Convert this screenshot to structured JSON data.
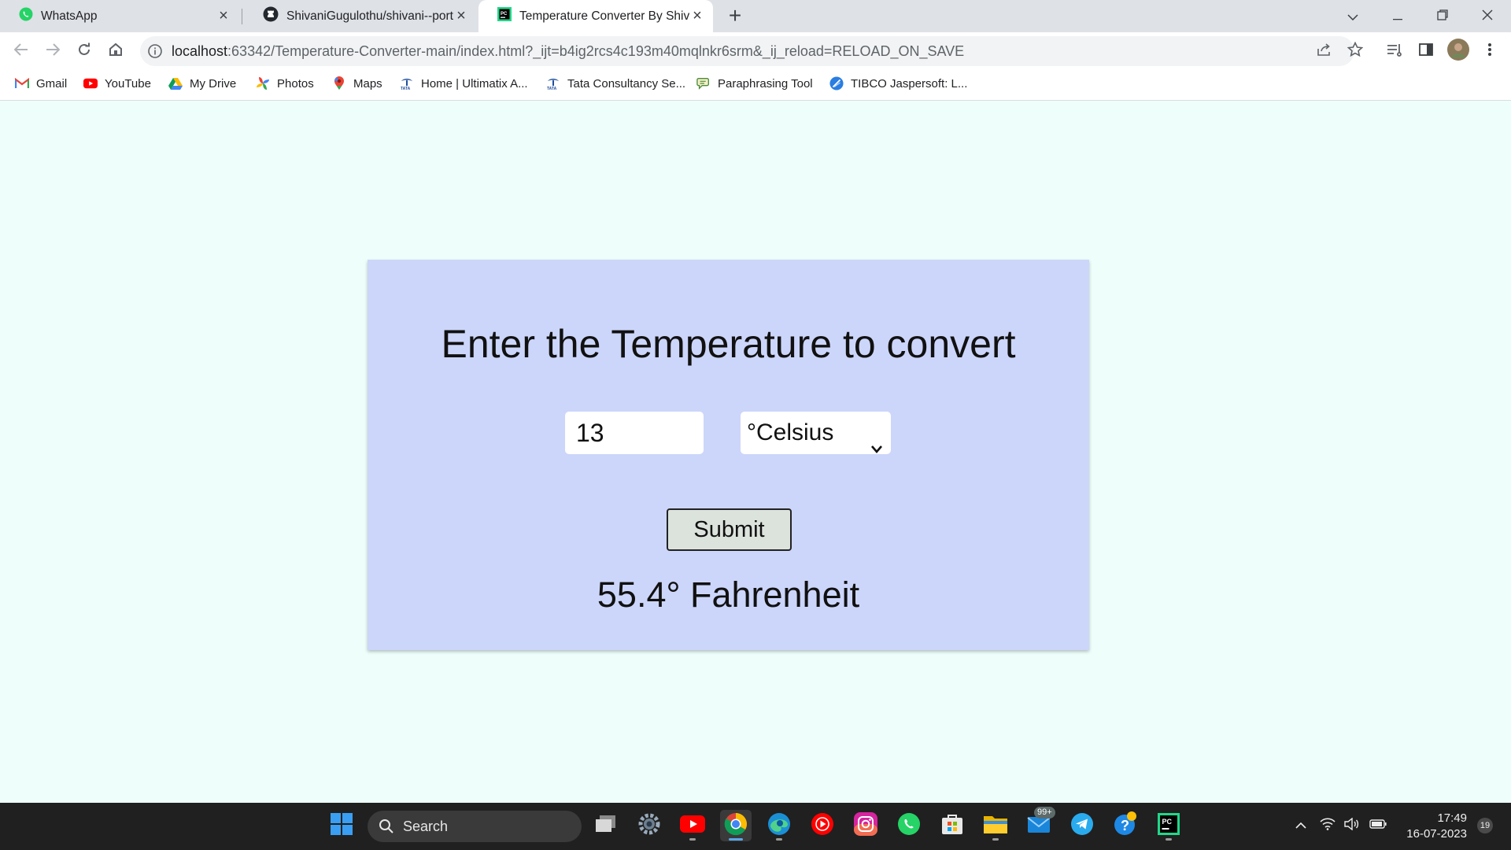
{
  "browser": {
    "tabs": [
      {
        "title": "WhatsApp",
        "icon": "whatsapp-icon"
      },
      {
        "title": "ShivaniGugulothu/shivani--portfo",
        "icon": "github-icon"
      },
      {
        "title": "Temperature Converter By Shivani",
        "icon": "pycharm-icon",
        "active": true
      }
    ],
    "url_host": "localhost",
    "url_rest": ":63342/Temperature-Converter-main/index.html?_ijt=b4ig2rcs4c193m40mqlnkr6srm&_ij_reload=RELOAD_ON_SAVE",
    "bookmarks": [
      {
        "label": "Gmail",
        "icon": "gmail-icon"
      },
      {
        "label": "YouTube",
        "icon": "youtube-icon"
      },
      {
        "label": "My Drive",
        "icon": "google-drive-icon"
      },
      {
        "label": "Photos",
        "icon": "google-photos-icon"
      },
      {
        "label": "Maps",
        "icon": "google-maps-icon"
      },
      {
        "label": "Home | Ultimatix A...",
        "icon": "tata-icon"
      },
      {
        "label": "Tata Consultancy Se...",
        "icon": "tata-icon"
      },
      {
        "label": "Paraphrasing Tool",
        "icon": "paraphrasing-tool-icon"
      },
      {
        "label": "TIBCO Jaspersoft: L...",
        "icon": "jaspersoft-icon"
      }
    ]
  },
  "converter": {
    "heading": "Enter the Temperature to convert",
    "input_value": "13",
    "unit_selected": "°Celsius",
    "submit_label": "Submit",
    "result": "55.4° Fahrenheit"
  },
  "taskbar": {
    "search_label": "Search",
    "mail_badge": "99+",
    "time": "17:49",
    "date": "16-07-2023",
    "notifications": "19"
  },
  "colors": {
    "page_bg": "#eefffb",
    "card_bg": "#ccd6fa",
    "button_bg": "#dce3dd",
    "taskbar_bg": "#202020"
  }
}
